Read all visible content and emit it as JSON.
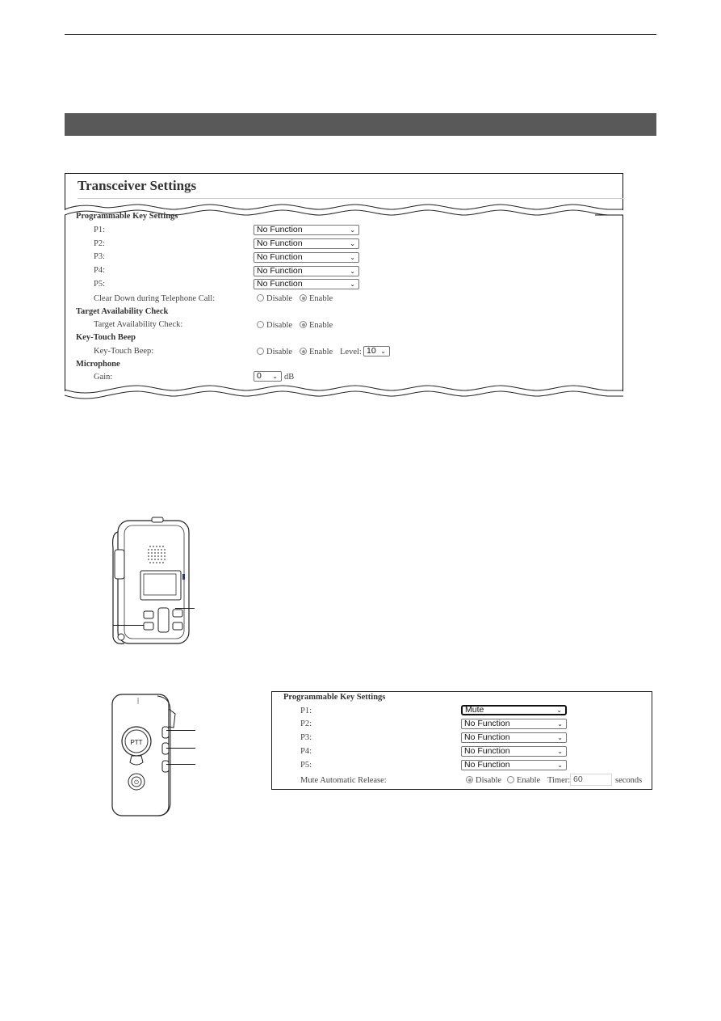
{
  "page": {
    "section_bar_color": "#5a5959"
  },
  "panel1": {
    "title": "Transceiver Settings",
    "groups": {
      "programmable_key_settings": "Programmable Key Settings",
      "target_availability_check": "Target Availability Check",
      "key_touch_beep": "Key-Touch Beep",
      "microphone": "Microphone"
    },
    "keys": [
      {
        "label": "P1:",
        "value": "No Function"
      },
      {
        "label": "P2:",
        "value": "No Function"
      },
      {
        "label": "P3:",
        "value": "No Function"
      },
      {
        "label": "P4:",
        "value": "No Function"
      },
      {
        "label": "P5:",
        "value": "No Function"
      }
    ],
    "clear_down": {
      "label": "Clear Down during Telephone Call:",
      "disable": "Disable",
      "enable": "Enable",
      "selected": "Enable"
    },
    "target_check": {
      "label": "Target Availability Check:",
      "disable": "Disable",
      "enable": "Enable",
      "selected": "Enable"
    },
    "key_beep": {
      "label": "Key-Touch Beep:",
      "disable": "Disable",
      "enable": "Enable",
      "selected": "Enable",
      "level_label": "Level:",
      "level_value": "10"
    },
    "gain": {
      "label": "Gain:",
      "value": "0",
      "unit": "dB"
    }
  },
  "device1": {
    "name": "transceiver-front-illustration"
  },
  "device2": {
    "name": "transceiver-side-illustration",
    "ptt_label": "PTT"
  },
  "panel2": {
    "title": "Programmable Key Settings",
    "keys": [
      {
        "label": "P1:",
        "value": "Mute"
      },
      {
        "label": "P2:",
        "value": "No Function"
      },
      {
        "label": "P3:",
        "value": "No Function"
      },
      {
        "label": "P4:",
        "value": "No Function"
      },
      {
        "label": "P5:",
        "value": "No Function"
      }
    ],
    "mute_release": {
      "label": "Mute Automatic Release:",
      "disable": "Disable",
      "enable": "Enable",
      "selected": "Disable",
      "timer_label": "Timer:",
      "timer_value": "60",
      "unit": "seconds"
    }
  }
}
